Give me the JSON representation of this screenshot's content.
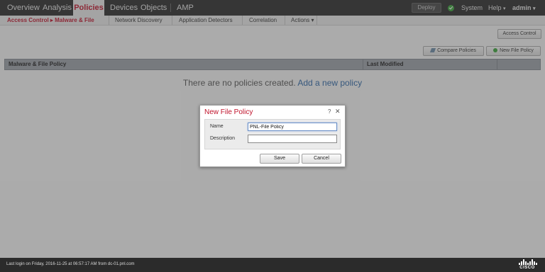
{
  "topnav": {
    "items": [
      "Overview",
      "Analysis",
      "Policies",
      "Devices",
      "Objects",
      "AMP"
    ],
    "active": "Policies",
    "deploy_label": "Deploy",
    "system_label": "System",
    "help_label": "Help",
    "user_label": "admin",
    "caret": "▾"
  },
  "subnav": {
    "breadcrumb": "Access Control ▸ Malware & File",
    "items": [
      "Network Discovery",
      "Application Detectors",
      "Correlation",
      "Actions ▾"
    ]
  },
  "toolbar": {
    "access_control_label": "Access Control",
    "compare_label": "Compare Policies",
    "new_policy_label": "New File Policy"
  },
  "table": {
    "columns": [
      "Malware & File Policy",
      "Last Modified"
    ],
    "empty_text": "There are no policies created.",
    "add_link": "Add a new policy"
  },
  "dialog": {
    "title": "New File Policy",
    "help": "?",
    "close": "✕",
    "name_label": "Name",
    "name_value": "PNL-File Policy",
    "description_label": "Description",
    "description_value": "",
    "save_label": "Save",
    "cancel_label": "Cancel"
  },
  "footer": {
    "last_login": "Last login on Friday, 2016-11-25 at 06:57:17 AM from dc-01.pnl.com",
    "logo_text": "CISCO"
  },
  "colors": {
    "accent_red": "#c0142c",
    "link_blue": "#2e67a6",
    "nav_dark": "#2b2b2b",
    "status_green": "#3aa43a"
  }
}
